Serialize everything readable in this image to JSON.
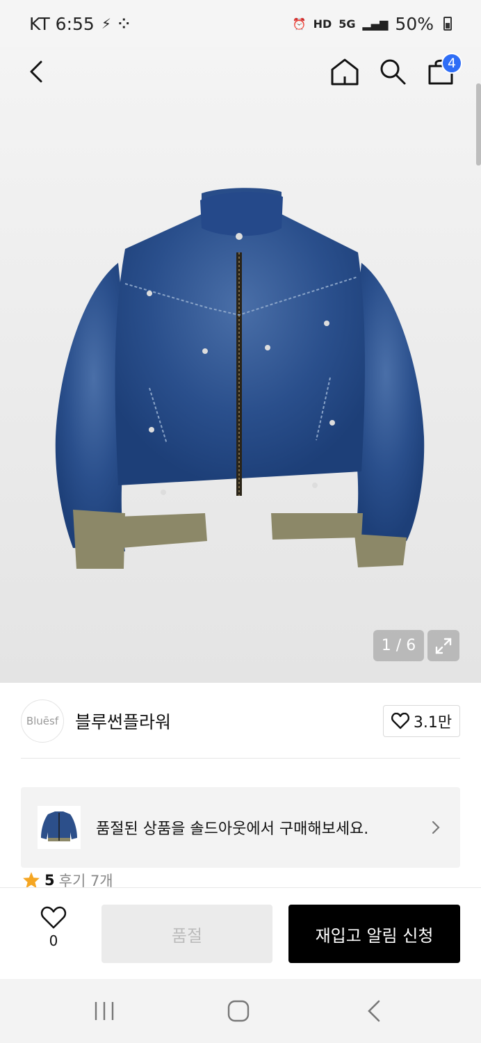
{
  "status_bar": {
    "carrier_time": "KT 6:55",
    "left_icons": [
      "bolt-v-icon",
      "settings-dots-icon"
    ],
    "right_icons": [
      "alarm-icon",
      "hd-icon",
      "5g-icon",
      "signal-icon"
    ],
    "hd": "HD",
    "fiveg": "5G",
    "battery": "50%"
  },
  "nav": {
    "cart_count": "4",
    "icons": [
      "back-icon",
      "home-icon",
      "search-icon",
      "shopping-bag-icon"
    ]
  },
  "gallery": {
    "pager": "1 / 6",
    "current_image": 1,
    "total_images": 6
  },
  "brand": {
    "logo_text": "Bluēsf",
    "name": "블루썬플라워",
    "like_count": "3.1만"
  },
  "banner": {
    "text": "품절된 상품을 솔드아웃에서 구매해보세요."
  },
  "rating": {
    "score": "5",
    "reviews": "후기 7개"
  },
  "bottom_bar": {
    "wish_count": "0",
    "soldout_label": "품절",
    "restock_label": "재입고 알림 신청"
  },
  "colors": {
    "accent_badge": "#2e6df6",
    "primary_button": "#000000",
    "star": "#f5a623"
  }
}
